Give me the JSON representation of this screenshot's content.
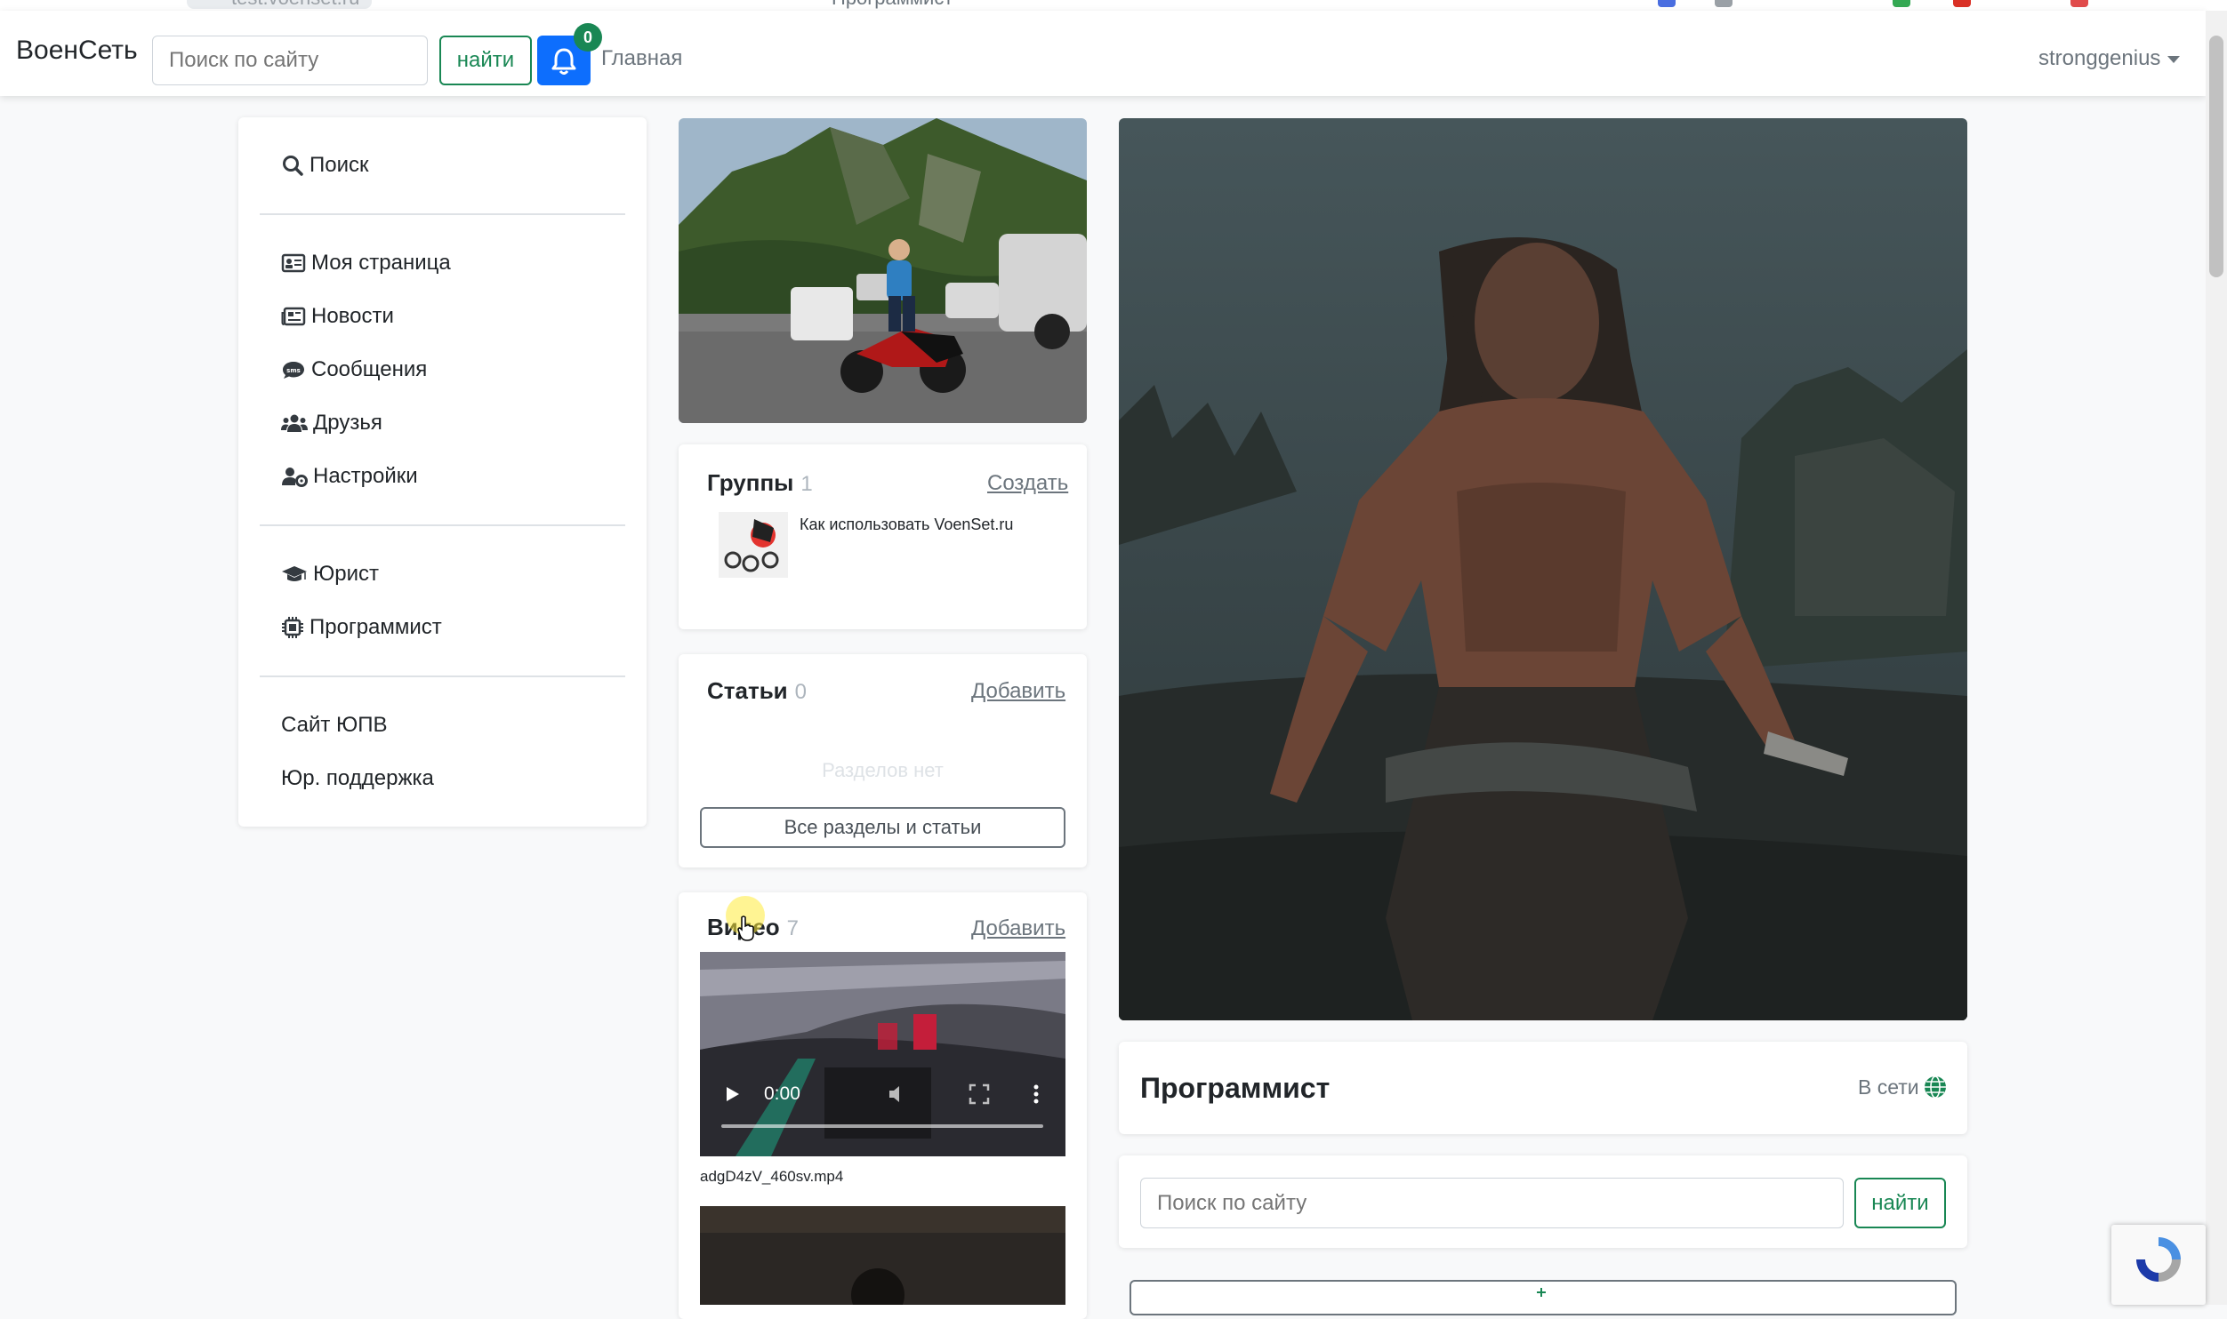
{
  "browser": {
    "url": "test.voenset.ru",
    "page_title": "Программист"
  },
  "navbar": {
    "brand": "ВоенСеть",
    "search_placeholder": "Поиск по сайту",
    "search_button": "найти",
    "notifications_count": "0",
    "home_link": "Главная",
    "username": "stronggenius"
  },
  "sidebar": {
    "search": "Поиск",
    "items": [
      {
        "label": "Моя страница",
        "icon": "id-card-icon"
      },
      {
        "label": "Новости",
        "icon": "newspaper-icon"
      },
      {
        "label": "Сообщения",
        "icon": "sms-bubble-icon"
      },
      {
        "label": "Друзья",
        "icon": "users-icon"
      },
      {
        "label": "Настройки",
        "icon": "user-cog-icon"
      }
    ],
    "sections": [
      {
        "label": "Юрист",
        "icon": "graduation-cap-icon"
      },
      {
        "label": "Программист",
        "icon": "microchip-icon"
      }
    ],
    "links": [
      "Сайт ЮПВ",
      "Юр. поддержка"
    ]
  },
  "groups": {
    "title": "Группы",
    "count": "1",
    "create_link": "Создать",
    "items": [
      {
        "name": "Как использовать VoenSet.ru"
      }
    ]
  },
  "articles": {
    "title": "Статьи",
    "count": "0",
    "add_link": "Добавить",
    "empty_text": "Разделов нет",
    "all_button": "Все разделы и статьи"
  },
  "videos": {
    "title": "Видео",
    "count": "7",
    "add_link": "Добавить",
    "items": [
      {
        "time": "0:00",
        "filename": "adgD4zV_460sv.mp4"
      }
    ]
  },
  "profile": {
    "title": "Программист",
    "status": "В сети",
    "search_placeholder": "Поиск по сайту",
    "search_button": "найти"
  },
  "colors": {
    "primary": "#0d6efd",
    "success": "#198754",
    "muted": "#6c757d"
  }
}
